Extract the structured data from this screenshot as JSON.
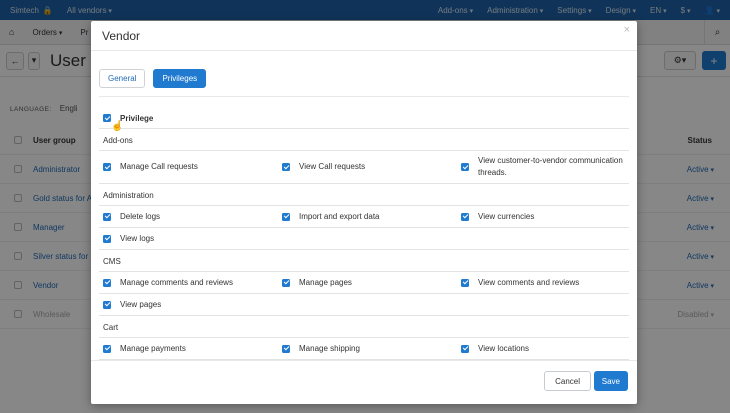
{
  "topbar": {
    "brand": "Simtech",
    "vendors": "All vendors",
    "menus": [
      "Add-ons",
      "Administration",
      "Settings",
      "Design",
      "EN",
      "$"
    ]
  },
  "navbar": {
    "orders": "Orders",
    "partial": "Pr"
  },
  "page": {
    "title": "User g"
  },
  "language": {
    "label": "LANGUAGE:",
    "value": "Engli"
  },
  "background_table": {
    "headers": {
      "name": "User group",
      "status": "Status"
    },
    "rows": [
      {
        "name": "Administrator",
        "status": "Active"
      },
      {
        "name": "Gold status for A",
        "status": "Active"
      },
      {
        "name": "Manager",
        "status": "Active"
      },
      {
        "name": "Silver status for",
        "status": "Active"
      },
      {
        "name": "Vendor",
        "status": "Active"
      },
      {
        "name": "Wholesale",
        "status": "Disabled"
      }
    ]
  },
  "modal": {
    "title": "Vendor",
    "close": "×",
    "tabs": {
      "general": "General",
      "privileges": "Privileges"
    },
    "privilege_header": "Privilege",
    "sections": [
      {
        "name": "Add-ons",
        "items": [
          "Manage Call requests",
          "View Call requests",
          "View customer-to-vendor communication threads."
        ]
      },
      {
        "name": "Administration",
        "items": [
          "Delete logs",
          "Import and export data",
          "View currencies",
          "View logs"
        ]
      },
      {
        "name": "CMS",
        "items": [
          "Manage comments and reviews",
          "Manage pages",
          "View comments and reviews",
          "View pages"
        ]
      },
      {
        "name": "Cart",
        "items": [
          "Manage payments",
          "Manage shipping",
          "View locations"
        ]
      }
    ],
    "buttons": {
      "cancel": "Cancel",
      "save": "Save"
    }
  },
  "colors": {
    "primary": "#1f7ad0",
    "topbar": "#1f63a8"
  }
}
